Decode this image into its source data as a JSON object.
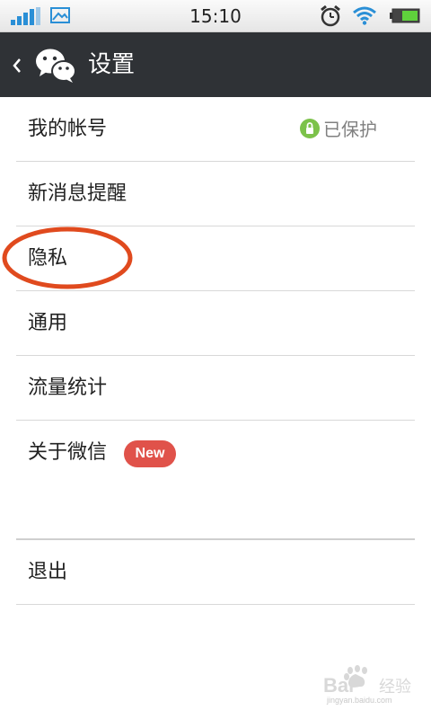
{
  "status_bar": {
    "time": "15:10",
    "icons": [
      "signal-icon",
      "gallery-icon",
      "alarm-icon",
      "wifi-icon",
      "battery-icon"
    ]
  },
  "header": {
    "title": "设置",
    "back_icon": "back-arrow-icon",
    "logo_icon": "wechat-logo-icon"
  },
  "settings": {
    "items": [
      {
        "label": "我的帐号",
        "status": "已保护",
        "status_icon": "lock-icon"
      },
      {
        "label": "新消息提醒"
      },
      {
        "label": "隐私"
      },
      {
        "label": "通用"
      },
      {
        "label": "流量统计"
      },
      {
        "label": "关于微信",
        "badge": "New"
      }
    ],
    "logout_label": "退出"
  },
  "watermark": {
    "logo_text": "Baidu 经验",
    "url": "jingyan.baidu.com"
  },
  "colors": {
    "header_bg": "#2f3236",
    "badge_bg": "#e0524a",
    "protect_green": "#7cc24a",
    "annotation_red": "#e04a1e",
    "signal_blue": "#2a8fd6"
  }
}
